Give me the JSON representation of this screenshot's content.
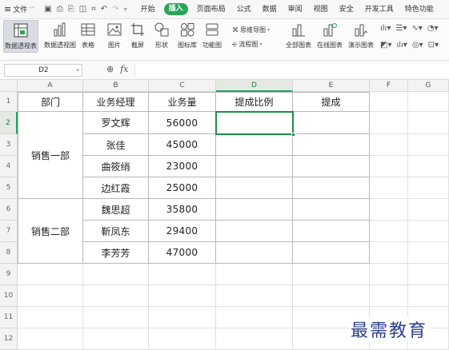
{
  "menubar": {
    "file_label": "文件",
    "tabs": [
      "开始",
      "插入",
      "页面布局",
      "公式",
      "数据",
      "审阅",
      "视图",
      "安全",
      "开发工具",
      "特色功能"
    ],
    "active_tab": "插入"
  },
  "ribbon": {
    "pivot_table": "数据透视表",
    "pivot_chart": "数据透视图",
    "table": "表格",
    "picture": "图片",
    "screenshot": "截屏",
    "shapes": "形状",
    "icon_library": "图标库",
    "function_chart": "功能图",
    "mind_map": "思维导图",
    "flowchart": "流程图",
    "all_charts": "全部图表",
    "online_charts": "在线图表",
    "demo_charts": "演示图表"
  },
  "formula_bar": {
    "cell_ref": "D2",
    "fx_label": "fx",
    "content": ""
  },
  "sheet": {
    "columns": [
      "A",
      "B",
      "C",
      "D",
      "E",
      "F",
      "G"
    ],
    "active_column": "D",
    "rows": [
      "1",
      "2",
      "3",
      "4",
      "5",
      "6",
      "7",
      "8",
      "9",
      "10",
      "11",
      "12"
    ],
    "active_row": "2",
    "headers": {
      "department": "部门",
      "manager": "业务经理",
      "volume": "业务量",
      "commission_ratio": "提成比例",
      "commission": "提成"
    },
    "departments": [
      "销售一部",
      "销售二部"
    ],
    "records": [
      {
        "manager": "罗文辉",
        "volume": "56000"
      },
      {
        "manager": "张佳",
        "volume": "45000"
      },
      {
        "manager": "曲筱绡",
        "volume": "23000"
      },
      {
        "manager": "边红霞",
        "volume": "25000"
      },
      {
        "manager": "魏思超",
        "volume": "35800"
      },
      {
        "manager": "靳凤东",
        "volume": "29400"
      },
      {
        "manager": "李芳芳",
        "volume": "47000"
      }
    ]
  },
  "watermark": "最需教育",
  "colors": {
    "accent": "#29a55a",
    "selection": "#1d8d4a",
    "watermark": "#2c3f8f"
  }
}
